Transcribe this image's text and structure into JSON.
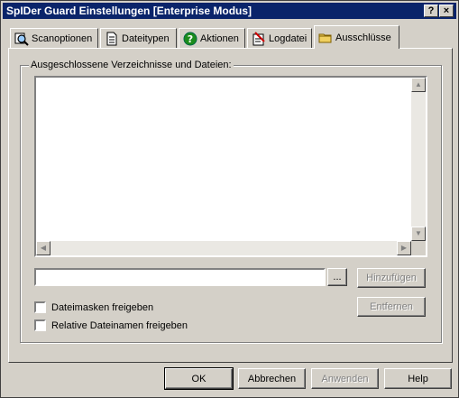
{
  "window": {
    "title": "SpIDer Guard Einstellungen [Enterprise Modus]"
  },
  "titlebar_buttons": {
    "help": "?",
    "close": "×"
  },
  "tabs": [
    {
      "label": "Scanoptionen",
      "icon": "magnifier-icon"
    },
    {
      "label": "Dateitypen",
      "icon": "document-icon"
    },
    {
      "label": "Aktionen",
      "icon": "question-icon"
    },
    {
      "label": "Logdatei",
      "icon": "log-icon"
    },
    {
      "label": "Ausschlüsse",
      "icon": "folder-icon"
    }
  ],
  "active_tab": "Ausschlüsse",
  "exclusions": {
    "group_label": "Ausgeschlossene Verzeichnisse und Dateien:",
    "items": [],
    "path_value": "",
    "browse_label": "...",
    "add_label": "Hinzufügen",
    "remove_label": "Entfernen",
    "checkbox_masks": {
      "label": "Dateimasken freigeben",
      "checked": false
    },
    "checkbox_relative": {
      "label": "Relative Dateinamen freigeben",
      "checked": false
    }
  },
  "footer": {
    "ok": "OK",
    "cancel": "Abbrechen",
    "apply": "Anwenden",
    "help": "Help"
  },
  "colors": {
    "titlebar": "#0a246a",
    "face": "#d4d0c8",
    "disabled_text": "#808080"
  }
}
